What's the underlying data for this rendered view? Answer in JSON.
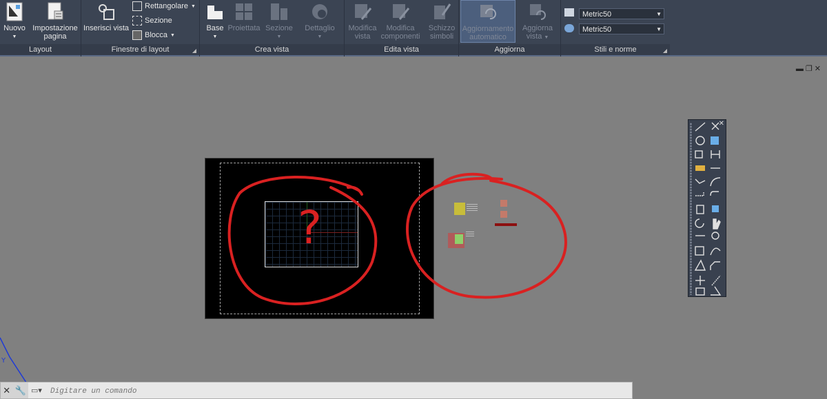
{
  "ribbon": {
    "panels": {
      "layout": "Layout",
      "layout_windows": "Finestre di layout",
      "create_view": "Crea vista",
      "edit_view": "Edita vista",
      "update": "Aggiorna",
      "styles": "Stili e norme"
    },
    "buttons": {
      "new": "Nuovo",
      "page_setup_l1": "Impostazione",
      "page_setup_l2": "pagina",
      "insert_view": "Inserisci vista",
      "rectangular": "Rettangolare",
      "section_small": "Sezione",
      "block": "Blocca",
      "base": "Base",
      "projected": "Proiettata",
      "section": "Sezione",
      "detail": "Dettaglio",
      "edit_view_l1": "Modifica",
      "edit_view_l2": "vista",
      "edit_components_l1": "Modifica",
      "edit_components_l2": "componenti",
      "symbol_sketch_l1": "Schizzo",
      "symbol_sketch_l2": "simboli",
      "auto_update_l1": "Aggiornamento",
      "auto_update_l2": "automatico",
      "update_view_l1": "Aggiorna",
      "update_view_l2": "vista"
    },
    "styles": {
      "style1": "Metric50",
      "style2": "Metric50"
    }
  },
  "annotation": {
    "question_mark": "?"
  },
  "command_line": {
    "placeholder": "Digitare un comando"
  },
  "colors": {
    "ribbon_bg": "#3b4453",
    "canvas_bg": "#808080",
    "markup_red": "#d92121"
  }
}
